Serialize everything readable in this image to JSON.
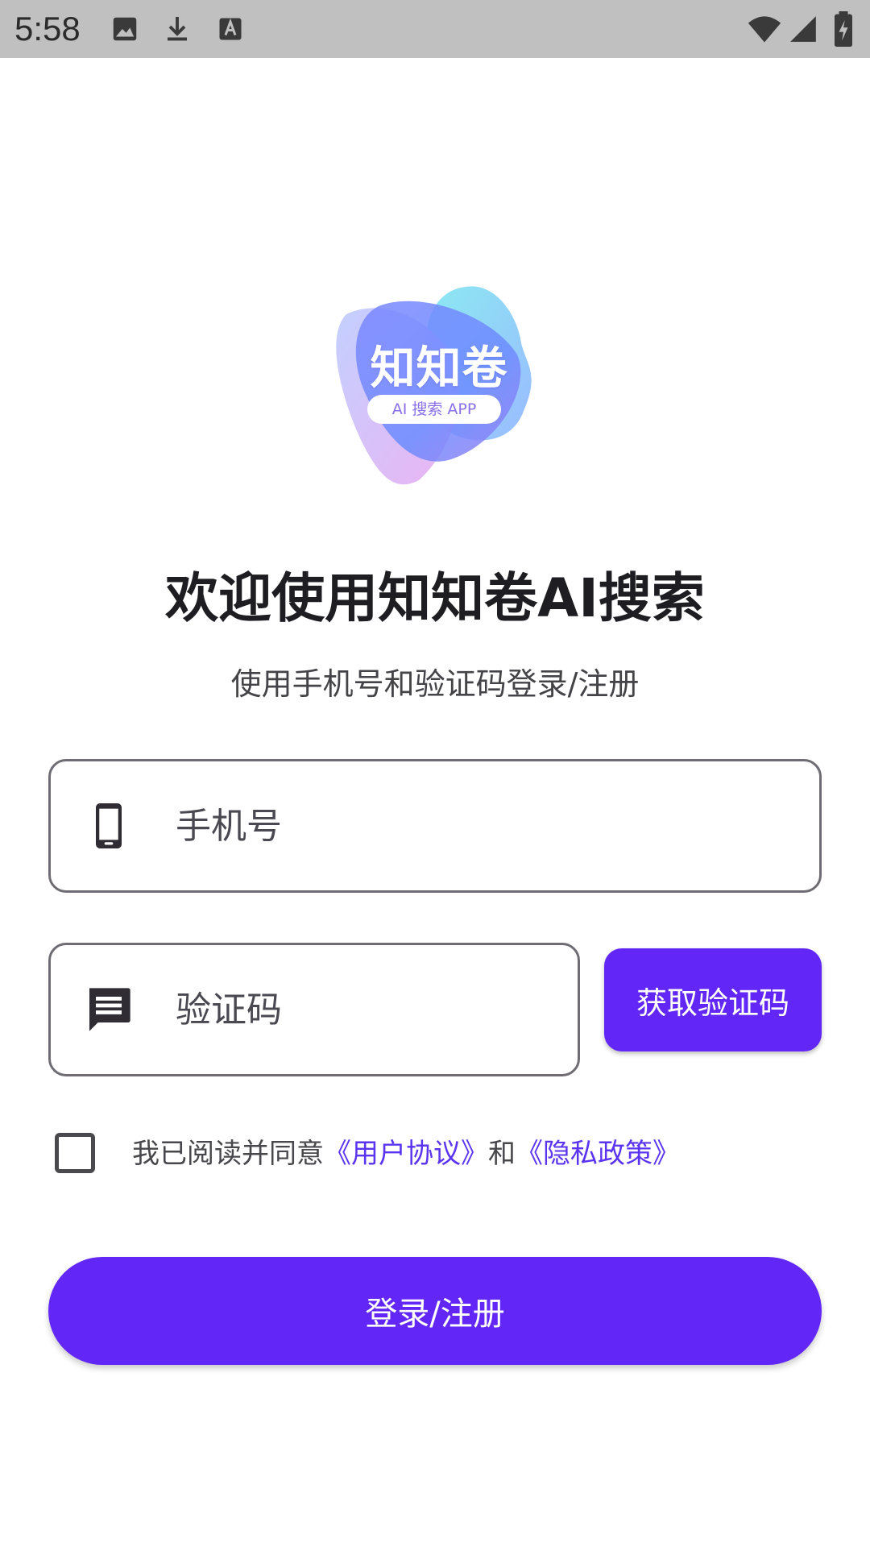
{
  "status_bar": {
    "time": "5:58",
    "left_icons": [
      "image-icon",
      "download-icon",
      "text-a-icon"
    ],
    "right_icons": [
      "wifi-icon",
      "signal-icon",
      "battery-charging-icon"
    ]
  },
  "logo": {
    "title": "知知卷",
    "tagline": "AI 搜索 APP"
  },
  "header": {
    "title": "欢迎使用知知卷AI搜索",
    "subtitle": "使用手机号和验证码登录/注册"
  },
  "form": {
    "phone_placeholder": "手机号",
    "phone_value": "",
    "code_placeholder": "验证码",
    "code_value": "",
    "get_code_label": "获取验证码"
  },
  "agreement": {
    "checked": false,
    "prefix": "我已阅读并同意",
    "user_agreement": "《用户协议》",
    "conjunction": "和",
    "privacy_policy": "《隐私政策》"
  },
  "login_label": "登录/注册",
  "colors": {
    "accent": "#6227f7",
    "link": "#5a34f0",
    "status_bar": "#c0c0c0",
    "title_text": "#1e1e22",
    "border": "#6f6d73"
  }
}
